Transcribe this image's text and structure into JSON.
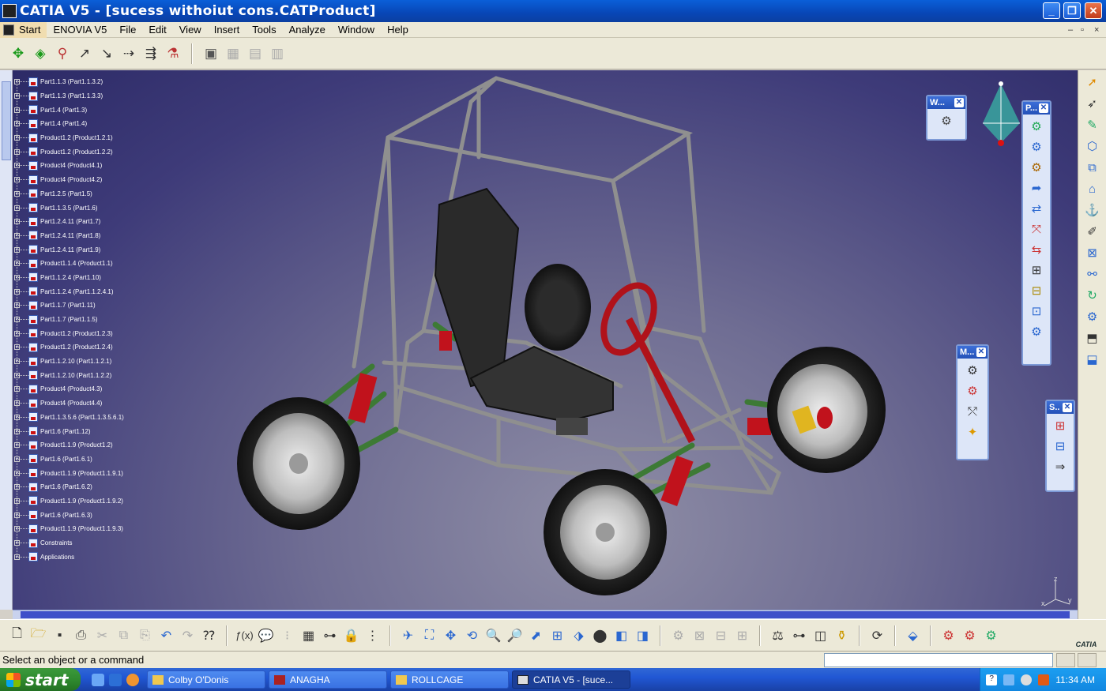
{
  "window": {
    "title": "CATIA V5 - [sucess withoiut cons.CATProduct]",
    "icon": "catia-app-icon",
    "controls": [
      "_",
      "❐",
      "✕"
    ]
  },
  "menu": {
    "items": [
      "Start",
      "ENOVIA V5",
      "File",
      "Edit",
      "View",
      "Insert",
      "Tools",
      "Analyze",
      "Window",
      "Help"
    ],
    "mdi_controls": [
      "–",
      "▫",
      "×"
    ]
  },
  "tree": {
    "items": [
      "Part1.1.3 (Part1.1.3.2)",
      "Part1.1.3 (Part1.1.3.3)",
      "Part1.4 (Part1.3)",
      "Part1.4 (Part1.4)",
      "Product1.2 (Product1.2.1)",
      "Product1.2 (Product1.2.2)",
      "Product4 (Product4.1)",
      "Product4 (Product4.2)",
      "Part1.2.5 (Part1.5)",
      "Part1.1.3.5 (Part1.6)",
      "Part1.2.4.11 (Part1.7)",
      "Part1.2.4.11 (Part1.8)",
      "Part1.2.4.11 (Part1.9)",
      "Product1.1.4 (Product1.1)",
      "Part1.1.2.4 (Part1.10)",
      "Part1.1.2.4 (Part1.1.2.4.1)",
      "Part1.1.7 (Part1.11)",
      "Part1.1.7 (Part1.1.5)",
      "Product1.2 (Product1.2.3)",
      "Product1.2 (Product1.2.4)",
      "Part1.1.2.10 (Part1.1.2.1)",
      "Part1.1.2.10 (Part1.1.2.2)",
      "Product4 (Product4.3)",
      "Product4 (Product4.4)",
      "Part1.1.3.5.6 (Part1.1.3.5.6.1)",
      "Part1.6 (Part1.12)",
      "Product1.1.9 (Product1.2)",
      "Part1.6 (Part1.6.1)",
      "Product1.1.9 (Product1.1.9.1)",
      "Part1.6 (Part1.6.2)",
      "Product1.1.9 (Product1.1.9.2)",
      "Part1.6 (Part1.6.3)",
      "Product1.1.9 (Product1.1.9.3)",
      "Constraints",
      "Applications"
    ]
  },
  "floating_toolbars": {
    "w": {
      "title": "W...",
      "icons": [
        "gear-icon"
      ]
    },
    "p": {
      "title": "P...",
      "icons": [
        "component-icon",
        "product-icon",
        "part-icon",
        "existing-component-icon",
        "replace-icon",
        "graph-tree-icon",
        "generate-numbering-icon",
        "selective-load-icon",
        "manage-representations-icon",
        "multi-instantiation-icon",
        "fast-multi-instantiation-icon",
        "reorder-icon"
      ]
    },
    "m": {
      "title": "M...",
      "icons": [
        "manipulation-icon",
        "snap-icon",
        "explode-icon",
        "stop-manipulate-icon"
      ]
    },
    "s": {
      "title": "S..",
      "icons": [
        "scene-icon",
        "enhanced-scene-icon",
        "apply-scene-icon"
      ]
    }
  },
  "axis_labels": {
    "z": "z",
    "y": "y",
    "x": "x"
  },
  "status": {
    "message": "Select an object or a command"
  },
  "brand": {
    "logo_text": "CATIA"
  },
  "taskbar": {
    "start_label": "start",
    "tasks": [
      {
        "label": "Colby O'Donis",
        "icon": "folder-icon"
      },
      {
        "label": "ANAGHA",
        "icon": "app-icon"
      },
      {
        "label": "ROLLCAGE",
        "icon": "folder-icon"
      },
      {
        "label": "CATIA V5 - [suce...",
        "icon": "catia-icon"
      }
    ],
    "clock": "11:34 AM"
  },
  "colors": {
    "title_bar": "#0846b6",
    "viewport_top": "#2c2a66",
    "viewport_bottom": "#8f8ea6",
    "taskbar": "#2157d4",
    "start_green": "#2f8a2f",
    "frame_tube": "#8a8a8a",
    "suspension_green": "#3d7a35",
    "spring_red": "#c1121c"
  }
}
